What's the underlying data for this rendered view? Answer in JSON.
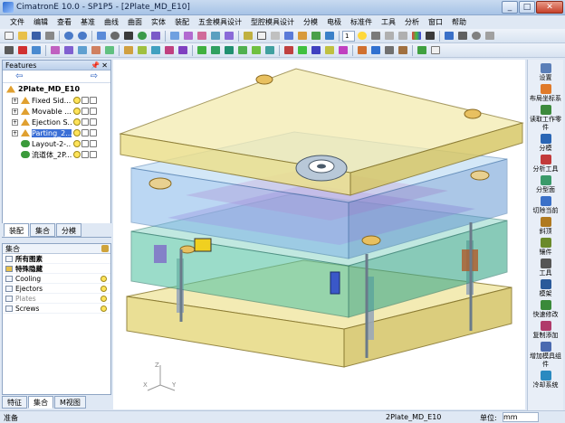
{
  "window": {
    "title": "CimatronE 10.0 - SP1P5 - [2Plate_MD_E10]",
    "btn_min": "_",
    "btn_max": "□",
    "btn_close": "✕"
  },
  "menu": [
    "文件",
    "编辑",
    "查看",
    "基准",
    "曲线",
    "曲面",
    "实体",
    "装配",
    "五金模具设计",
    "型腔模具设计",
    "分模",
    "电极",
    "标准件",
    "工具",
    "分析",
    "窗口",
    "帮助"
  ],
  "toolbar": {
    "zoom_value": "1",
    "icons": [
      "new-icon",
      "open-icon",
      "save-icon",
      "print-icon",
      "undo-icon",
      "redo-icon",
      "select-icon",
      "zoom-icon",
      "pan-icon",
      "rotate-icon",
      "view-icon",
      "shade-icon"
    ]
  },
  "features_panel": {
    "title": "Features",
    "pin": "📌",
    "close": "✕",
    "back_arrow": "⇦",
    "forward_arrow": "⇨",
    "root_label": "2Plate_MD_E10",
    "items": [
      {
        "label": "Fixed Sid...",
        "expander": "+",
        "selected": false
      },
      {
        "label": "Movable ...",
        "expander": "+",
        "selected": false
      },
      {
        "label": "Ejection S...",
        "expander": "+",
        "selected": false
      },
      {
        "label": "Parting_2...",
        "expander": "+",
        "selected": true
      },
      {
        "label": "Layout-2-...",
        "expander": "",
        "selected": false
      },
      {
        "label": "流道体_2P...",
        "expander": "",
        "selected": false
      }
    ],
    "tabs": [
      "装配",
      "集合",
      "分模"
    ]
  },
  "sets_panel": {
    "header": "集合",
    "rows": [
      {
        "label": "所有图素",
        "bold": true,
        "grey": false
      },
      {
        "label": "特殊隐藏",
        "bold": true,
        "grey": false
      },
      {
        "label": "Cooling",
        "bold": false,
        "grey": false
      },
      {
        "label": "Ejectors",
        "bold": false,
        "grey": false
      },
      {
        "label": "Plates",
        "bold": false,
        "grey": true
      },
      {
        "label": "Screws",
        "bold": false,
        "grey": false
      }
    ],
    "tabs": [
      "特征",
      "集合",
      "M视图"
    ]
  },
  "right_panel": [
    {
      "label": "设置",
      "color": "#5b7fb8"
    },
    {
      "label": "布局坐标系",
      "color": "#e07a2a"
    },
    {
      "label": "读取工作零件",
      "color": "#3c8a3c"
    },
    {
      "label": "分模",
      "color": "#2a66b5"
    },
    {
      "label": "分析工具",
      "color": "#c23a3a"
    },
    {
      "label": "分型面",
      "color": "#3a9a6a"
    },
    {
      "label": "切除当前",
      "color": "#3a70c8"
    },
    {
      "label": "斜顶",
      "color": "#b07a20"
    },
    {
      "label": "镶件",
      "color": "#6a8a2a"
    },
    {
      "label": "工具",
      "color": "#555555"
    },
    {
      "label": "模架",
      "color": "#2a5a9a"
    },
    {
      "label": "快速修改",
      "color": "#3a8a3a"
    },
    {
      "label": "复制添加",
      "color": "#b03a6a"
    },
    {
      "label": "增加模具组件",
      "color": "#4a6ab0"
    },
    {
      "label": "冷却系统",
      "color": "#2a8ac0"
    }
  ],
  "status": {
    "left": "准备",
    "file": "2Plate_MD_E10",
    "units_label": "单位:",
    "units_value": "mm"
  },
  "axis": {
    "x": "X",
    "y": "Y",
    "z": "Z"
  }
}
